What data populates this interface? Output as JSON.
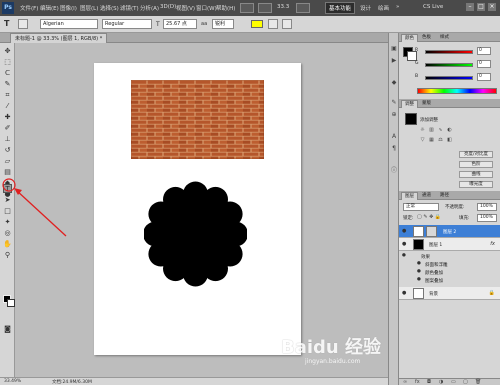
{
  "menubar": {
    "logo": "Ps",
    "items": [
      "文件(F)",
      "编辑(E)",
      "图像(I)",
      "图层(L)",
      "选择(S)",
      "滤镜(T)",
      "分析(A)",
      "3D(D)",
      "视图(V)",
      "窗口(W)",
      "帮助(H)"
    ],
    "zoom": "33.3",
    "mode_button": "基本功能",
    "tabs": [
      "设计",
      "绘画"
    ],
    "cs_live": "CS Live"
  },
  "options": {
    "tool_icon": "T",
    "font_family": "Algerian",
    "font_style": "Regular",
    "font_size": "25.67 点",
    "aa_label": "aa",
    "aa_mode": "锐利",
    "swatch_color": "#ffff00"
  },
  "doc_tab": {
    "label": "未标题-1 @ 33.3% (图层 1, RGB/8) *"
  },
  "status": {
    "zoom": "33.49%",
    "doc_info": "文档:24.9M/6.30M"
  },
  "watermark": {
    "text": "Baidu 经验",
    "sub": "jingyan.baidu.com"
  },
  "panels": {
    "color_tabs": [
      "颜色",
      "色板",
      "样式"
    ],
    "sliders": [
      {
        "label": "R",
        "value": "0",
        "color_start": "#000000",
        "color_end": "#ff0000"
      },
      {
        "label": "G",
        "value": "0",
        "color_start": "#000000",
        "color_end": "#00ff00"
      },
      {
        "label": "B",
        "value": "0",
        "color_start": "#000000",
        "color_end": "#0000ff"
      }
    ],
    "adjust_tabs": [
      "调整",
      "蒙版"
    ],
    "adjust_title": "添加调整",
    "adjust_buttons": [
      "亮度/对比度",
      "色阶",
      "曲线",
      "曝光度"
    ]
  },
  "layers": {
    "tabs": [
      "图层",
      "通道",
      "路径"
    ],
    "blend_mode": "正常",
    "opacity_label": "不透明度:",
    "opacity_value": "100%",
    "lock_label": "锁定:",
    "fill_label": "填充:",
    "fill_value": "100%",
    "rows": [
      {
        "name": "图层 2",
        "selected": true
      },
      {
        "name": "图层 1",
        "selected": false,
        "fx": "fx"
      },
      {
        "name": "背景",
        "selected": false
      }
    ],
    "effects_label": "效果",
    "effects": [
      "斜面和浮雕",
      "颜色叠加",
      "图案叠加"
    ]
  },
  "colors": {
    "brick": "#b5562b",
    "mortar": "#d79a6c",
    "flower": "#000000",
    "annotation": "#e02020",
    "selection": "#3d7fd6"
  }
}
